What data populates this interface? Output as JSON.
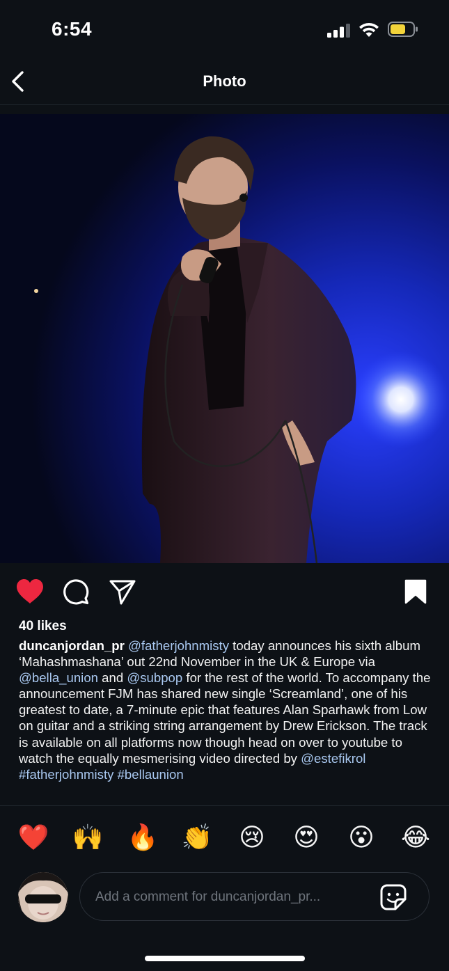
{
  "status": {
    "time": "6:54"
  },
  "nav": {
    "title": "Photo"
  },
  "post": {
    "likes": "40 likes",
    "caption": {
      "username": "duncanjordan_pr",
      "mention_fjm": "@fatherjohnmisty",
      "text_1": " today announces his sixth album ‘Mahashmashana’ out 22nd November in the UK & Europe via ",
      "mention_bella": "@bella_union",
      "text_2": " and ",
      "mention_subpop": "@subpop",
      "text_3": " for the rest of the world. To accompany the announcement FJM has shared new single ‘Screamland’, one of his greatest to date, a 7-minute epic that features Alan Sparhawk from Low on guitar and a striking string arrangement by Drew Erickson. The track is available on all platforms now though head on over to youtube to watch the equally mesmerising video directed by ",
      "mention_estefi": "@estefikrol",
      "hashtag_1": "#fatherjohnmisty",
      "hashtag_2": "#bellaunion"
    },
    "liked": true,
    "saved": true
  },
  "reactions": [
    "❤️",
    "🙌",
    "🔥",
    "👏",
    "😢",
    "😍",
    "😮",
    "😂"
  ],
  "comment": {
    "placeholder": "Add a comment for duncanjordan_pr..."
  },
  "colors": {
    "background": "#0d1116",
    "like_red": "#ed2740",
    "link_blue": "#a9c8f0"
  },
  "icons": {
    "back": "chevron-left-icon",
    "like": "heart-icon",
    "comment": "comment-bubble-icon",
    "share": "paper-plane-icon",
    "save": "bookmark-icon",
    "sticker": "sticker-icon"
  }
}
